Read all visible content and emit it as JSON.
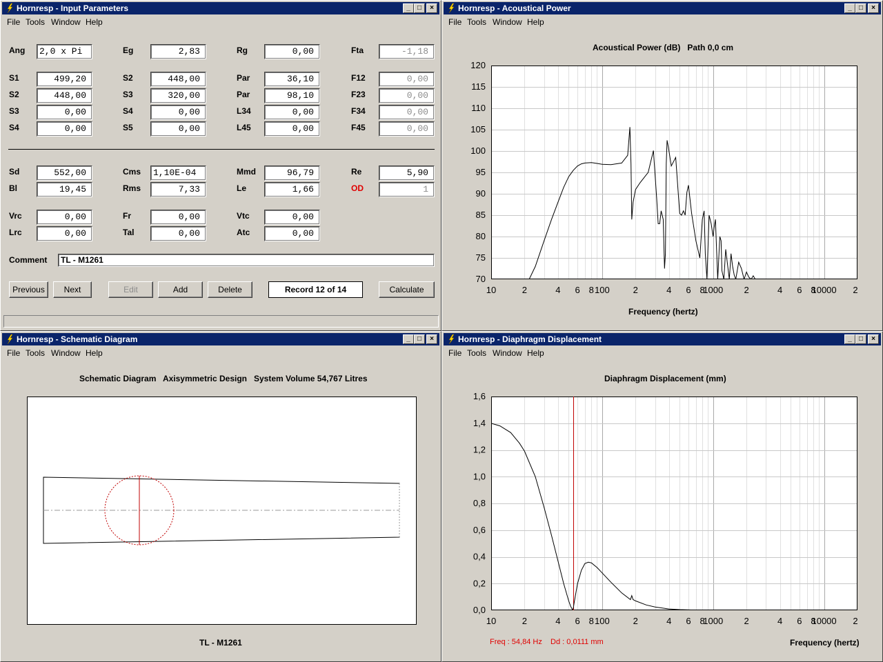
{
  "input_window": {
    "title": "Hornresp - Input Parameters",
    "menu": [
      "File",
      "Tools",
      "Window",
      "Help"
    ],
    "rows": [
      [
        {
          "label": "Ang",
          "value": "2,0 x Pi",
          "align": "left"
        },
        {
          "label": "Eg",
          "value": "2,83"
        },
        {
          "label": "Rg",
          "value": "0,00"
        },
        {
          "label": "Fta",
          "value": "-1,18",
          "grey": true
        }
      ],
      [
        {
          "label": "S1",
          "value": "499,20"
        },
        {
          "label": "S2",
          "value": "448,00"
        },
        {
          "label": "Par",
          "value": "36,10"
        },
        {
          "label": "F12",
          "value": "0,00",
          "grey": true
        }
      ],
      [
        {
          "label": "S2",
          "value": "448,00"
        },
        {
          "label": "S3",
          "value": "320,00"
        },
        {
          "label": "Par",
          "value": "98,10"
        },
        {
          "label": "F23",
          "value": "0,00",
          "grey": true
        }
      ],
      [
        {
          "label": "S3",
          "value": "0,00"
        },
        {
          "label": "S4",
          "value": "0,00"
        },
        {
          "label": "L34",
          "value": "0,00"
        },
        {
          "label": "F34",
          "value": "0,00",
          "grey": true
        }
      ],
      [
        {
          "label": "S4",
          "value": "0,00"
        },
        {
          "label": "S5",
          "value": "0,00"
        },
        {
          "label": "L45",
          "value": "0,00"
        },
        {
          "label": "F45",
          "value": "0,00",
          "grey": true
        }
      ],
      [
        {
          "label": "Sd",
          "value": "552,00"
        },
        {
          "label": "Cms",
          "value": "1,10E-04",
          "align": "left"
        },
        {
          "label": "Mmd",
          "value": "96,79"
        },
        {
          "label": "Re",
          "value": "5,90"
        }
      ],
      [
        {
          "label": "Bl",
          "value": "19,45"
        },
        {
          "label": "Rms",
          "value": "7,33"
        },
        {
          "label": "Le",
          "value": "1,66"
        },
        {
          "label": "OD",
          "value": "1",
          "grey": true,
          "red": true
        }
      ],
      [
        {
          "label": "Vrc",
          "value": "0,00"
        },
        {
          "label": "Fr",
          "value": "0,00"
        },
        {
          "label": "Vtc",
          "value": "0,00"
        }
      ],
      [
        {
          "label": "Lrc",
          "value": "0,00"
        },
        {
          "label": "Tal",
          "value": "0,00"
        },
        {
          "label": "Atc",
          "value": "0,00"
        }
      ]
    ],
    "comment_label": "Comment",
    "comment_value": "TL - M1261",
    "buttons": {
      "previous": "Previous",
      "next": "Next",
      "edit": "Edit",
      "add": "Add",
      "delete": "Delete",
      "calculate": "Calculate"
    },
    "record": "Record 12 of 14"
  },
  "power_window": {
    "title": "Hornresp - Acoustical Power",
    "menu": [
      "File",
      "Tools",
      "Window",
      "Help"
    ],
    "chart_title": "Acoustical Power (dB)   Path 0,0 cm",
    "xlabel": "Frequency (hertz)"
  },
  "schematic_window": {
    "title": "Hornresp - Schematic Diagram",
    "menu": [
      "File",
      "Tools",
      "Window",
      "Help"
    ],
    "header": "Schematic Diagram   Axisymmetric Design   System Volume 54,767 Litres",
    "footer": "TL - M1261"
  },
  "displacement_window": {
    "title": "Hornresp - Diaphragm Displacement",
    "menu": [
      "File",
      "Tools",
      "Window",
      "Help"
    ],
    "chart_title": "Diaphragm Displacement (mm)",
    "xlabel": "Frequency (hertz)",
    "readout": "Freq : 54,84 Hz    Dd : 0,0111 mm"
  },
  "chart_data": [
    {
      "type": "line",
      "title": "Acoustical Power (dB)   Path 0,0 cm",
      "xlabel": "Frequency (hertz)",
      "ylabel": "",
      "xscale": "log",
      "xlim": [
        10,
        20000
      ],
      "ylim": [
        70,
        120
      ],
      "yticks": [
        70,
        75,
        80,
        85,
        90,
        95,
        100,
        105,
        110,
        115,
        120
      ],
      "xtick_labels": [
        "10",
        "2",
        "4",
        "6",
        "8",
        "100",
        "2",
        "4",
        "6",
        "8",
        "1000",
        "2",
        "4",
        "6",
        "8",
        "10000",
        "2"
      ],
      "grid": true,
      "x": [
        10,
        20,
        22,
        25,
        30,
        35,
        40,
        45,
        50,
        55,
        60,
        65,
        70,
        80,
        90,
        100,
        120,
        150,
        170,
        178,
        182,
        185,
        190,
        200,
        220,
        260,
        290,
        310,
        320,
        330,
        340,
        355,
        365,
        372,
        378,
        385,
        395,
        420,
        460,
        500,
        520,
        540,
        560,
        580,
        600,
        640,
        700,
        760,
        800,
        830,
        850,
        880,
        920,
        960,
        1000,
        1020,
        1050,
        1100,
        1150,
        1180,
        1200,
        1250,
        1300,
        1400,
        1450,
        1500,
        1550,
        1600,
        1700,
        1800,
        1900,
        2000,
        2100,
        2200,
        2300,
        2400,
        2500,
        2600,
        2700,
        2800,
        2900,
        3000,
        3200
      ],
      "values": [
        null,
        null,
        70,
        73,
        79,
        84,
        88,
        91.5,
        94,
        95.5,
        96.5,
        97,
        97.2,
        97.3,
        97.1,
        96.9,
        96.8,
        97.2,
        99,
        105.6,
        97,
        84,
        88,
        91,
        92.6,
        95,
        100.1,
        89,
        83,
        83,
        86,
        84,
        72.5,
        76,
        97,
        102.5,
        101,
        96.5,
        98.5,
        85.4,
        85,
        86,
        85,
        90.3,
        92,
        85.5,
        79,
        75,
        84,
        86,
        76,
        70,
        85,
        83,
        80,
        82,
        84,
        70,
        80,
        79,
        72,
        70,
        77,
        70,
        76,
        73,
        71,
        70,
        74,
        72.5,
        70,
        71.7,
        70.5,
        70,
        70.8,
        70,
        70,
        70,
        70,
        70,
        70,
        70,
        70
      ]
    },
    {
      "type": "line",
      "title": "Diaphragm Displacement (mm)",
      "xlabel": "Frequency (hertz)",
      "ylabel": "",
      "xscale": "log",
      "xlim": [
        10,
        20000
      ],
      "ylim": [
        0,
        1.6
      ],
      "yticks": [
        "0,0",
        "0,2",
        "0,4",
        "0,6",
        "0,8",
        "1,0",
        "1,2",
        "1,4",
        "1,6"
      ],
      "xtick_labels": [
        "10",
        "2",
        "4",
        "6",
        "8",
        "100",
        "2",
        "4",
        "6",
        "8",
        "1000",
        "2",
        "4",
        "6",
        "8",
        "10000",
        "2"
      ],
      "grid": true,
      "marker_frequency": 54.84,
      "x": [
        10,
        12,
        15,
        18,
        20,
        25,
        30,
        35,
        40,
        45,
        50,
        52,
        54,
        54.84,
        56,
        58,
        60,
        65,
        70,
        75,
        80,
        90,
        100,
        120,
        150,
        180,
        185,
        190,
        200,
        250,
        300,
        400,
        500,
        600,
        700,
        800,
        850,
        900
      ],
      "values": [
        1.4,
        1.38,
        1.33,
        1.25,
        1.19,
        1.0,
        0.77,
        0.56,
        0.37,
        0.2,
        0.07,
        0.03,
        0.005,
        0.0111,
        0.06,
        0.13,
        0.2,
        0.3,
        0.35,
        0.36,
        0.355,
        0.32,
        0.28,
        0.21,
        0.13,
        0.08,
        0.11,
        0.08,
        0.07,
        0.04,
        0.025,
        0.01,
        0.005,
        0.003,
        0.001,
        0.0,
        0.0,
        null
      ]
    }
  ]
}
